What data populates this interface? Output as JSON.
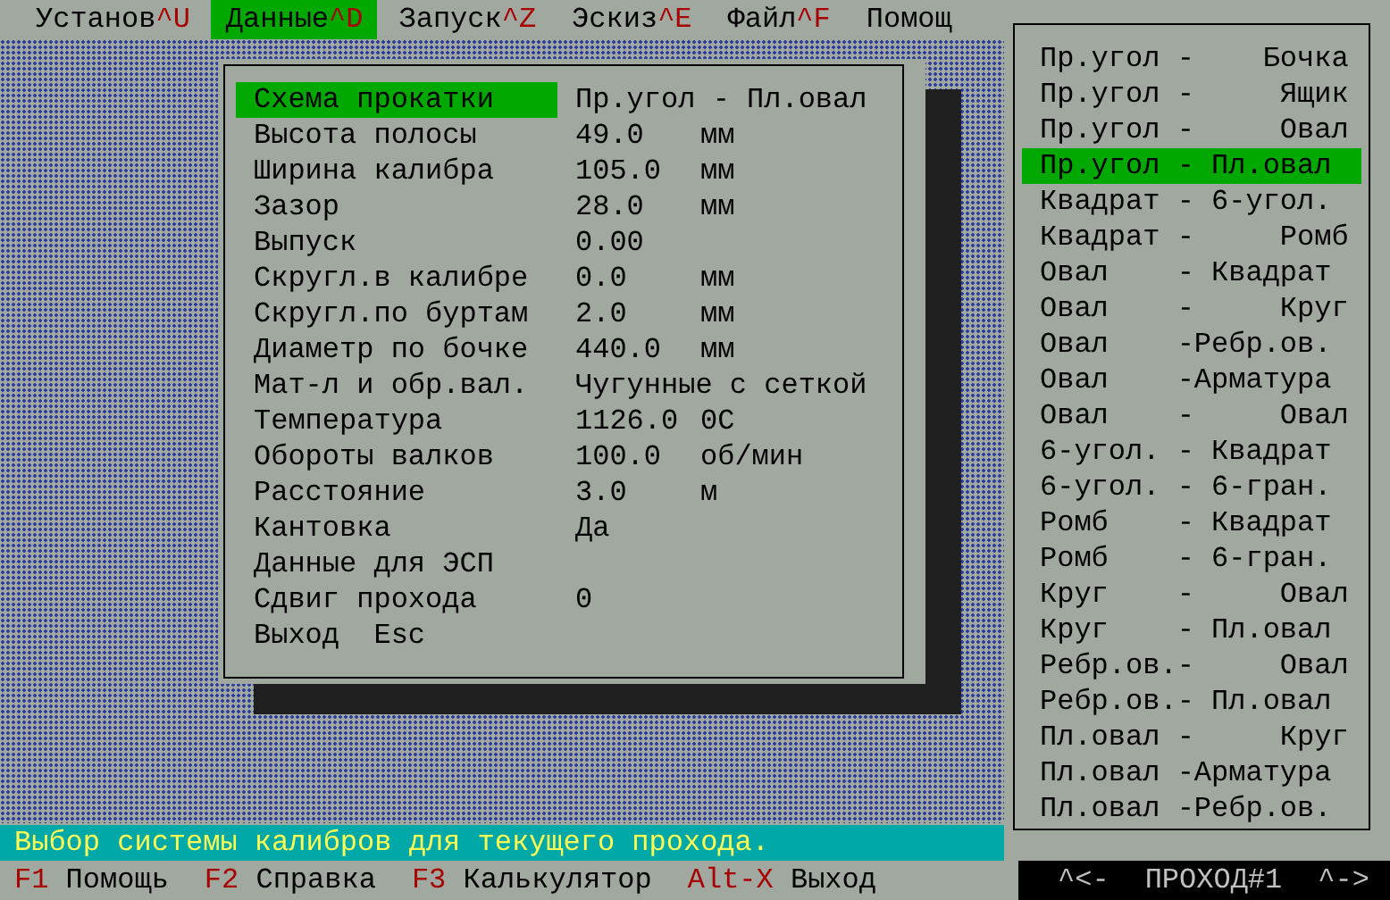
{
  "menu": [
    {
      "label": "Установ",
      "hotkey": "^U",
      "selected": false
    },
    {
      "label": "Данные",
      "hotkey": "^D",
      "selected": true
    },
    {
      "label": "Запуск",
      "hotkey": "^Z",
      "selected": false
    },
    {
      "label": "Эскиз",
      "hotkey": "^E",
      "selected": false
    },
    {
      "label": "Файл",
      "hotkey": "^F",
      "selected": false
    },
    {
      "label": "Помощ",
      "selected": false
    }
  ],
  "form": {
    "fields": [
      {
        "label": "Схема прокатки",
        "value": "Пр.угол - Пл.овал",
        "selected": true
      },
      {
        "label": "Высота полосы",
        "value": "49.0",
        "unit": "мм",
        "selected": false
      },
      {
        "label": "Ширина калибра",
        "value": "105.0",
        "unit": "мм",
        "selected": false
      },
      {
        "label": "Зазор",
        "value": "28.0",
        "unit": "мм",
        "selected": false
      },
      {
        "label": "Выпуск",
        "value": "0.00",
        "selected": false
      },
      {
        "label": "Скругл.в калибре",
        "value": "0.0",
        "unit": "мм",
        "selected": false
      },
      {
        "label": "Скругл.по буртам",
        "value": "2.0",
        "unit": "мм",
        "selected": false
      },
      {
        "label": "Диаметр по бочке",
        "value": "440.0",
        "unit": "мм",
        "selected": false
      },
      {
        "label": "Мат-л и обр.вал.",
        "value": "Чугунные с сеткой",
        "selected": false
      },
      {
        "label": "Температура",
        "value": "1126.0",
        "unit": "0C",
        "selected": false
      },
      {
        "label": "Обороты валков",
        "value": "100.0",
        "unit": "об/мин",
        "selected": false
      },
      {
        "label": "Расстояние",
        "value": "3.0",
        "unit": "м",
        "selected": false
      },
      {
        "label": "Кантовка",
        "value": "Да",
        "selected": false
      },
      {
        "label": "Данные для ЭСП",
        "selected": false
      },
      {
        "label": "Сдвиг прохода",
        "value": "0",
        "selected": false
      },
      {
        "label": "Выход  Esc",
        "selected": false
      }
    ]
  },
  "pass_list": {
    "items": [
      {
        "text": "Пр.угол -    Бочка",
        "selected": false
      },
      {
        "text": "Пр.угол -     Ящик",
        "selected": false
      },
      {
        "text": "Пр.угол -     Овал",
        "selected": false
      },
      {
        "text": "Пр.угол - Пл.овал",
        "selected": true
      },
      {
        "text": "Квадрат - 6-угол.",
        "selected": false
      },
      {
        "text": "Квадрат -     Ромб",
        "selected": false
      },
      {
        "text": "Овал    - Квадрат",
        "selected": false
      },
      {
        "text": "Овал    -     Круг",
        "selected": false
      },
      {
        "text": "Овал    -Ребр.ов.",
        "selected": false
      },
      {
        "text": "Овал    -Арматура",
        "selected": false
      },
      {
        "text": "Овал    -     Овал",
        "selected": false
      },
      {
        "text": "6-угол. - Квадрат",
        "selected": false
      },
      {
        "text": "6-угол. - 6-гран.",
        "selected": false
      },
      {
        "text": "Ромб    - Квадрат",
        "selected": false
      },
      {
        "text": "Ромб    - 6-гран.",
        "selected": false
      },
      {
        "text": "Круг    -     Овал",
        "selected": false
      },
      {
        "text": "Круг    - Пл.овал",
        "selected": false
      },
      {
        "text": "Ребр.ов.-     Овал",
        "selected": false
      },
      {
        "text": "Ребр.ов.- Пл.овал",
        "selected": false
      },
      {
        "text": "Пл.овал -     Круг",
        "selected": false
      },
      {
        "text": "Пл.овал -Арматура",
        "selected": false
      },
      {
        "text": "Пл.овал -Ребр.ов.",
        "selected": false
      }
    ]
  },
  "status_message": "Выбор системы калибров для текущего прохода.",
  "function_keys": [
    {
      "key": "F1",
      "label": "Помощь"
    },
    {
      "key": "F2",
      "label": "Справка"
    },
    {
      "key": "F3",
      "label": "Калькулятор"
    },
    {
      "key": "Alt-X",
      "label": "Выход"
    }
  ],
  "pass_indicator": {
    "previous": "^<-",
    "label": "ПРОХОД#1",
    "next": "^->"
  }
}
